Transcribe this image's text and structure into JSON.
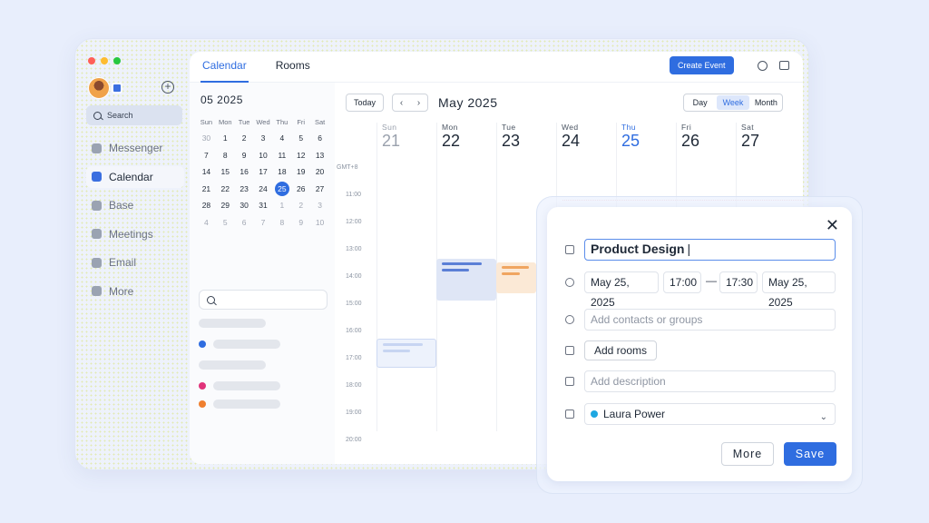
{
  "sidebar": {
    "search_label": "Search",
    "items": [
      {
        "label": "Messenger",
        "icon": "chat-icon",
        "active": false
      },
      {
        "label": "Calendar",
        "icon": "calendar-icon",
        "active": true
      },
      {
        "label": "Base",
        "icon": "base-icon",
        "active": false
      },
      {
        "label": "Meetings",
        "icon": "video-icon",
        "active": false
      },
      {
        "label": "Email",
        "icon": "mail-icon",
        "active": false
      },
      {
        "label": "More",
        "icon": "grid-icon",
        "active": false
      }
    ]
  },
  "header": {
    "tabs": [
      {
        "label": "Calendar",
        "active": true
      },
      {
        "label": "Rooms",
        "active": false
      }
    ],
    "create_label": "Create Event"
  },
  "mini_calendar": {
    "title": "05 2025",
    "weekdays": [
      "Sun",
      "Mon",
      "Tue",
      "Wed",
      "Thu",
      "Fri",
      "Sat"
    ],
    "days": [
      [
        "30",
        "1",
        "2",
        "3",
        "4",
        "5",
        "6"
      ],
      [
        "7",
        "8",
        "9",
        "10",
        "11",
        "12",
        "13"
      ],
      [
        "14",
        "15",
        "16",
        "17",
        "18",
        "19",
        "20"
      ],
      [
        "21",
        "22",
        "23",
        "24",
        "25",
        "26",
        "27"
      ],
      [
        "28",
        "29",
        "30",
        "31",
        "1",
        "2",
        "3"
      ],
      [
        "4",
        "5",
        "6",
        "7",
        "8",
        "9",
        "10"
      ]
    ],
    "muted": [
      [
        0,
        0
      ],
      [
        4,
        4
      ],
      [
        4,
        5
      ],
      [
        4,
        6
      ],
      [
        5,
        0
      ],
      [
        5,
        1
      ],
      [
        5,
        2
      ],
      [
        5,
        3
      ],
      [
        5,
        4
      ],
      [
        5,
        5
      ],
      [
        5,
        6
      ]
    ],
    "today": [
      3,
      4
    ]
  },
  "week_view": {
    "today_label": "Today",
    "title": "May 2025",
    "views": [
      "Day",
      "Week",
      "Month"
    ],
    "selected_view": "Week",
    "timezone": "GMT+8",
    "days": [
      {
        "name": "Sun",
        "date": "21",
        "state": "past"
      },
      {
        "name": "Mon",
        "date": "22",
        "state": "normal"
      },
      {
        "name": "Tue",
        "date": "23",
        "state": "normal"
      },
      {
        "name": "Wed",
        "date": "24",
        "state": "normal"
      },
      {
        "name": "Thu",
        "date": "25",
        "state": "current"
      },
      {
        "name": "Fri",
        "date": "26",
        "state": "normal"
      },
      {
        "name": "Sat",
        "date": "27",
        "state": "normal"
      }
    ],
    "hours": [
      "11:00",
      "12:00",
      "13:00",
      "14:00",
      "15:00",
      "16:00",
      "17:00",
      "18:00",
      "19:00",
      "20:00"
    ]
  },
  "event_dialog": {
    "title_value": "Product Design",
    "start_date": "May 25, 2025",
    "start_time": "17:00",
    "end_time": "17:30",
    "end_date": "May 25, 2025",
    "contacts_placeholder": "Add contacts or groups",
    "rooms_label": "Add rooms",
    "description_placeholder": "Add description",
    "calendar_owner": "Laura Power",
    "more_label": "More",
    "save_label": "Save"
  },
  "colors": {
    "accent": "#2f6de0",
    "owner_dot": "#1ea7e1",
    "mini_dot_blue": "#2f6de0",
    "mini_dot_pink": "#e0337a",
    "mini_dot_orange": "#ef7f2f"
  }
}
